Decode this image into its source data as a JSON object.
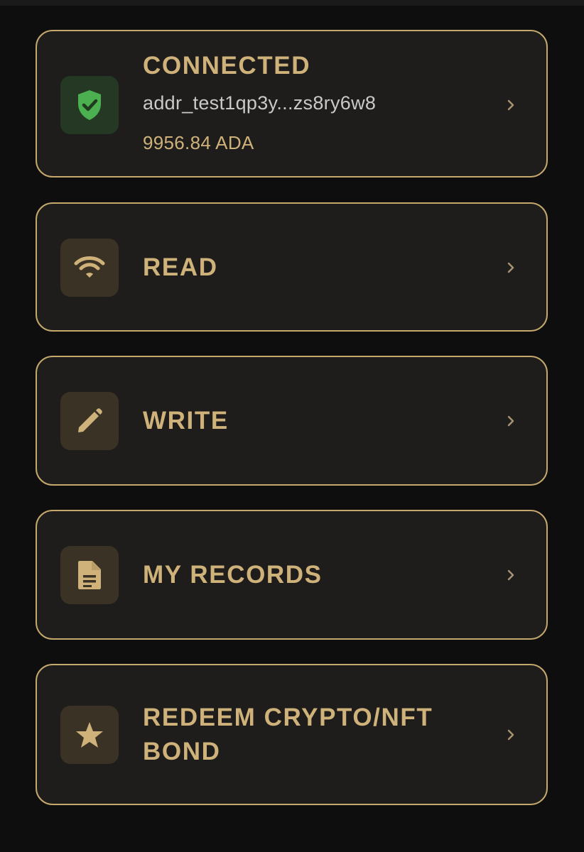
{
  "wallet": {
    "status": "CONNECTED",
    "address": "addr_test1qp3y...zs8ry6w8",
    "balance": "9956.84 ADA"
  },
  "menu": {
    "read": "READ",
    "write": "WRITE",
    "records": "MY RECORDS",
    "redeem_line1": "REDEEM CRYPTO/NFT",
    "redeem_line2": "BOND"
  },
  "icons": {
    "wallet": "shield-check-icon",
    "read": "wifi-icon",
    "write": "pencil-icon",
    "records": "document-icon",
    "redeem": "star-icon",
    "chevron": "chevron-right-icon"
  },
  "colors": {
    "accent": "#c4a86c",
    "text_gold": "#cfb27a",
    "success": "#4caf50",
    "card_bg": "#1e1d1c",
    "page_bg": "#0e0e0f"
  }
}
